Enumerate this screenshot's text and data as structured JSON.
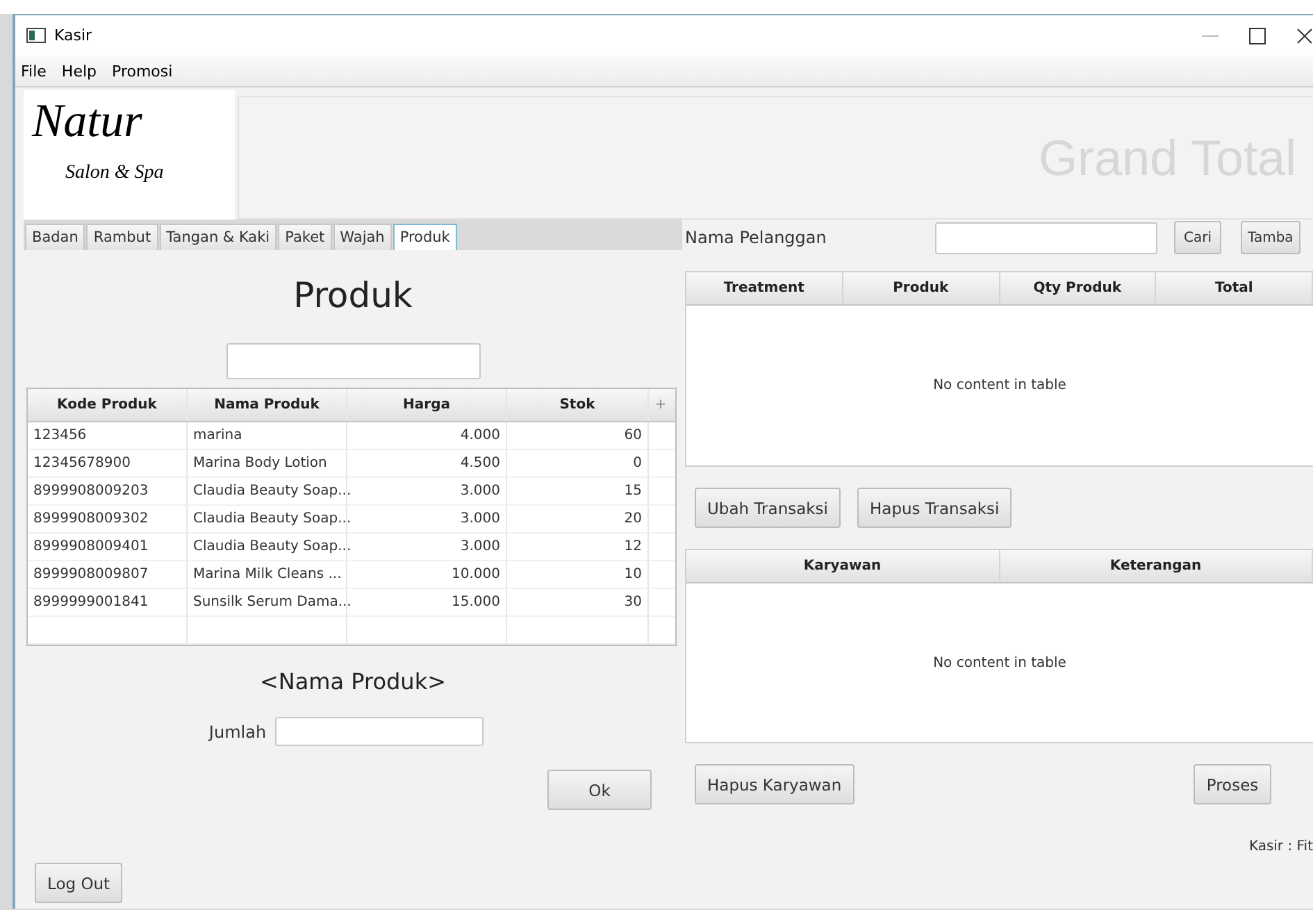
{
  "window": {
    "title": "Kasir"
  },
  "menu": [
    "File",
    "Help",
    "Promosi"
  ],
  "logo": {
    "title": "Natur",
    "subtitle": "Salon & Spa"
  },
  "grand_total": "Grand Total",
  "tabs": [
    {
      "label": "Badan",
      "selected": false
    },
    {
      "label": "Rambut",
      "selected": false
    },
    {
      "label": "Tangan & Kaki",
      "selected": false
    },
    {
      "label": "Paket",
      "selected": false
    },
    {
      "label": "Wajah",
      "selected": false
    },
    {
      "label": "Produk",
      "selected": true
    }
  ],
  "product_panel": {
    "heading": "Produk",
    "columns": [
      "Kode Produk",
      "Nama Produk",
      "Harga",
      "Stok",
      "+"
    ],
    "rows": [
      [
        "123456",
        "marina",
        "4.000",
        "60"
      ],
      [
        "12345678900",
        "Marina Body Lotion",
        "4.500",
        "0"
      ],
      [
        "8999908009203",
        "Claudia Beauty Soap...",
        "3.000",
        "15"
      ],
      [
        "8999908009302",
        "Claudia Beauty Soap...",
        "3.000",
        "20"
      ],
      [
        "8999908009401",
        "Claudia Beauty Soap...",
        "3.000",
        "12"
      ],
      [
        "8999908009807",
        "Marina Milk Cleans ...",
        "10.000",
        "10"
      ],
      [
        "8999999001841",
        "Sunsilk Serum Dama...",
        "15.000",
        "30"
      ]
    ],
    "product_name": "<Nama Produk>",
    "quantity_label": "Jumlah",
    "ok_button": "Ok"
  },
  "logout_button": "Log Out",
  "customer": {
    "label": "Nama Pelanggan",
    "search_button": "Cari",
    "add_button": "Tamba"
  },
  "transaction_table": {
    "columns": [
      "Treatment",
      "Produk",
      "Qty Produk",
      "Total"
    ],
    "empty_text": "No content in table"
  },
  "transaction_buttons": [
    "Ubah Transaksi",
    "Hapus Transaksi"
  ],
  "employee_table": {
    "columns": [
      "Karyawan",
      "Keterangan"
    ],
    "empty_text": "No content in table"
  },
  "employee_button": "Hapus Karyawan",
  "process_button": "Proses",
  "status": "Kasir : Fit"
}
